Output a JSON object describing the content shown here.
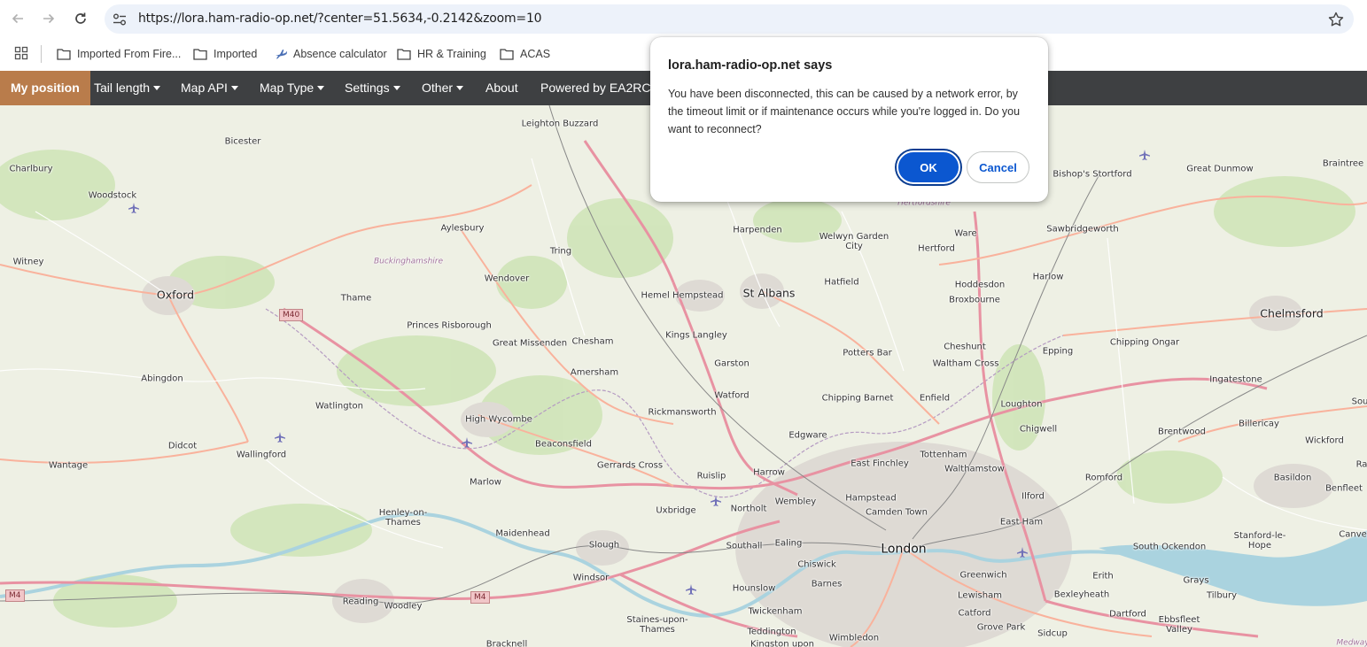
{
  "browser": {
    "url": "https://lora.ham-radio-op.net/?center=51.5634,-0.2142&zoom=10",
    "bookmarks": [
      "Imported From Fire...",
      "Imported",
      "Absence calculator",
      "HR & Training",
      "ACAS"
    ]
  },
  "site_menu": {
    "active": "My position",
    "items": [
      "Tail length",
      "Map API",
      "Map Type",
      "Settings",
      "Other",
      "About",
      "Powered by EA2RCF"
    ]
  },
  "dialog": {
    "title": "lora.ham-radio-op.net says",
    "message": "You have been disconnected, this can be caused by a network error, by the timeout limit or if maintenance occurs while you're logged in. Do you want to reconnect?",
    "ok_label": "OK",
    "cancel_label": "Cancel"
  },
  "map": {
    "places": [
      "Leighton Buzzard",
      "Bicester",
      "Charlbury",
      "Woodstock",
      "Witney",
      "Oxford",
      "Aylesbury",
      "Tring",
      "Wendover",
      "Thame",
      "Princes Risborough",
      "Great Missenden",
      "Chesham",
      "Amersham",
      "Hemel Hempstead",
      "St Albans",
      "Harpenden",
      "Welwyn Garden City",
      "Hertford",
      "Ware",
      "Hatfield",
      "Hoddesdon",
      "Broxbourne",
      "Bishop's Stortford",
      "Great Dunmow",
      "Braintree",
      "Sawbridgeworth",
      "Harlow",
      "Chelmsford",
      "Kings Langley",
      "Garston",
      "Watford",
      "Potters Bar",
      "Cheshunt",
      "Waltham Cross",
      "Epping",
      "Chipping Ongar",
      "Abingdon",
      "Watlington",
      "High Wycombe",
      "Rickmansworth",
      "Chipping Barnet",
      "Enfield",
      "Loughton",
      "Ingatestone",
      "Didcot",
      "Wallingford",
      "Wantage",
      "Beaconsfield",
      "Gerrards Cross",
      "Edgware",
      "Chigwell",
      "Brentwood",
      "Billericay",
      "Wickford",
      "Marlow",
      "Ruislip",
      "Harrow",
      "East Finchley",
      "Tottenham",
      "Walthamstow",
      "Romford",
      "Basildon",
      "Benfleet",
      "Henley-on-Thames",
      "Uxbridge",
      "Northolt",
      "Wembley",
      "Hampstead",
      "Camden Town",
      "Ilford",
      "East Ham",
      "Maidenhead",
      "Slough",
      "Southall",
      "Ealing",
      "London",
      "Chiswick",
      "Barnes",
      "Stanford-le-Hope",
      "South Ockendon",
      "Canvey",
      "Windsor",
      "Hounslow",
      "Greenwich",
      "Erith",
      "Grays",
      "Lewisham",
      "Bexleyheath",
      "Tilbury",
      "Reading",
      "Woodley",
      "Twickenham",
      "Catford",
      "Dartford",
      "Ebbsfleet Valley",
      "Staines-upon-Thames",
      "Teddington",
      "Grove Park",
      "Sidcup",
      "Wimbledon",
      "Bracknell",
      "Kingston upon",
      "Medway",
      "Hertfordshire",
      "Buckinghamshire",
      "Sou",
      "Ra"
    ],
    "roads": [
      "M40",
      "M4",
      "M4"
    ]
  },
  "icons": {
    "back": "arrow-left-icon",
    "forward": "arrow-right-icon",
    "reload": "reload-icon",
    "site_info": "tune-icon",
    "bookmark": "star-icon",
    "apps": "apps-grid-icon",
    "folder": "folder-icon",
    "airport": "airplane-icon"
  },
  "colors": {
    "menu_bg": "#3e4042",
    "menu_active": "#b97c4b",
    "ok_button": "#0b57d0",
    "map_motorway": "#e892a2",
    "map_trunk": "#f9b29c"
  }
}
